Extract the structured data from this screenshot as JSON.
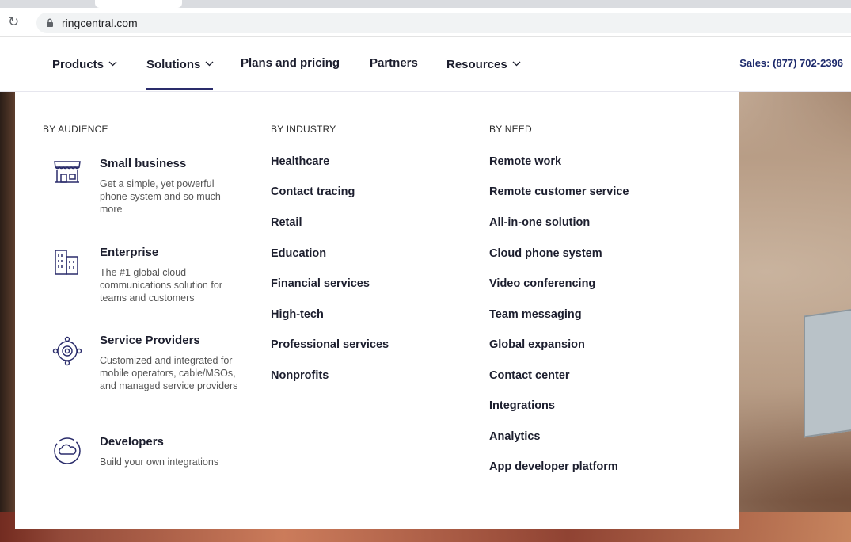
{
  "browser": {
    "url": "ringcentral.com"
  },
  "nav": {
    "items": [
      {
        "label": "Products",
        "has_dropdown": true
      },
      {
        "label": "Solutions",
        "has_dropdown": true,
        "active": true
      },
      {
        "label": "Plans and pricing",
        "has_dropdown": false
      },
      {
        "label": "Partners",
        "has_dropdown": false
      },
      {
        "label": "Resources",
        "has_dropdown": true
      }
    ],
    "sales": "Sales: (877) 702-2396"
  },
  "menu": {
    "by_audience": {
      "heading": "BY AUDIENCE",
      "items": [
        {
          "title": "Small business",
          "desc": "Get a simple, yet powerful phone system and so much more",
          "icon": "storefront-icon"
        },
        {
          "title": "Enterprise",
          "desc": "The #1 global cloud communications solution for teams and customers",
          "icon": "building-icon"
        },
        {
          "title": "Service Providers",
          "desc": "Customized and integrated for mobile operators, cable/MSOs, and managed service providers",
          "icon": "network-icon"
        },
        {
          "title": "Developers",
          "desc": "Build your own integrations",
          "icon": "cloud-icon"
        }
      ]
    },
    "by_industry": {
      "heading": "BY INDUSTRY",
      "items": [
        "Healthcare",
        "Contact tracing",
        "Retail",
        "Education",
        "Financial services",
        "High-tech",
        "Professional services",
        "Nonprofits"
      ]
    },
    "by_need": {
      "heading": "BY NEED",
      "items": [
        "Remote work",
        "Remote customer service",
        "All-in-one solution",
        "Cloud phone system",
        "Video conferencing",
        "Team messaging",
        "Global expansion",
        "Contact center",
        "Integrations",
        "Analytics",
        "App developer platform"
      ]
    }
  },
  "colors": {
    "nav_text": "#1c1e2e",
    "active_underline": "#2a2c6b",
    "sales_text": "#1d2a6c"
  }
}
